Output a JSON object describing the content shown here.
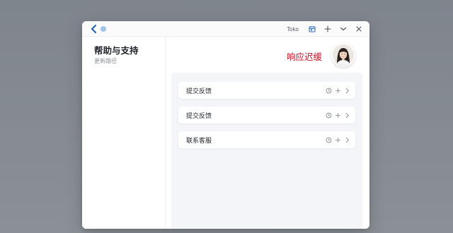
{
  "titlebar": {
    "app_label": "Toko",
    "icons": [
      "back-icon",
      "calendar-icon",
      "plus-icon",
      "chevron-down-icon",
      "close-icon"
    ]
  },
  "sidebar": {
    "title": "帮助与支持",
    "subtitle": "更新路径"
  },
  "main": {
    "status_text": "响应迟缓",
    "items": [
      {
        "label": "提交反馈"
      },
      {
        "label": "提交反馈"
      },
      {
        "label": "联系客服"
      }
    ]
  },
  "colors": {
    "accent_blue": "#1f5fb4",
    "alert_red": "#c5162a",
    "content_bg": "#f3f5f8"
  }
}
